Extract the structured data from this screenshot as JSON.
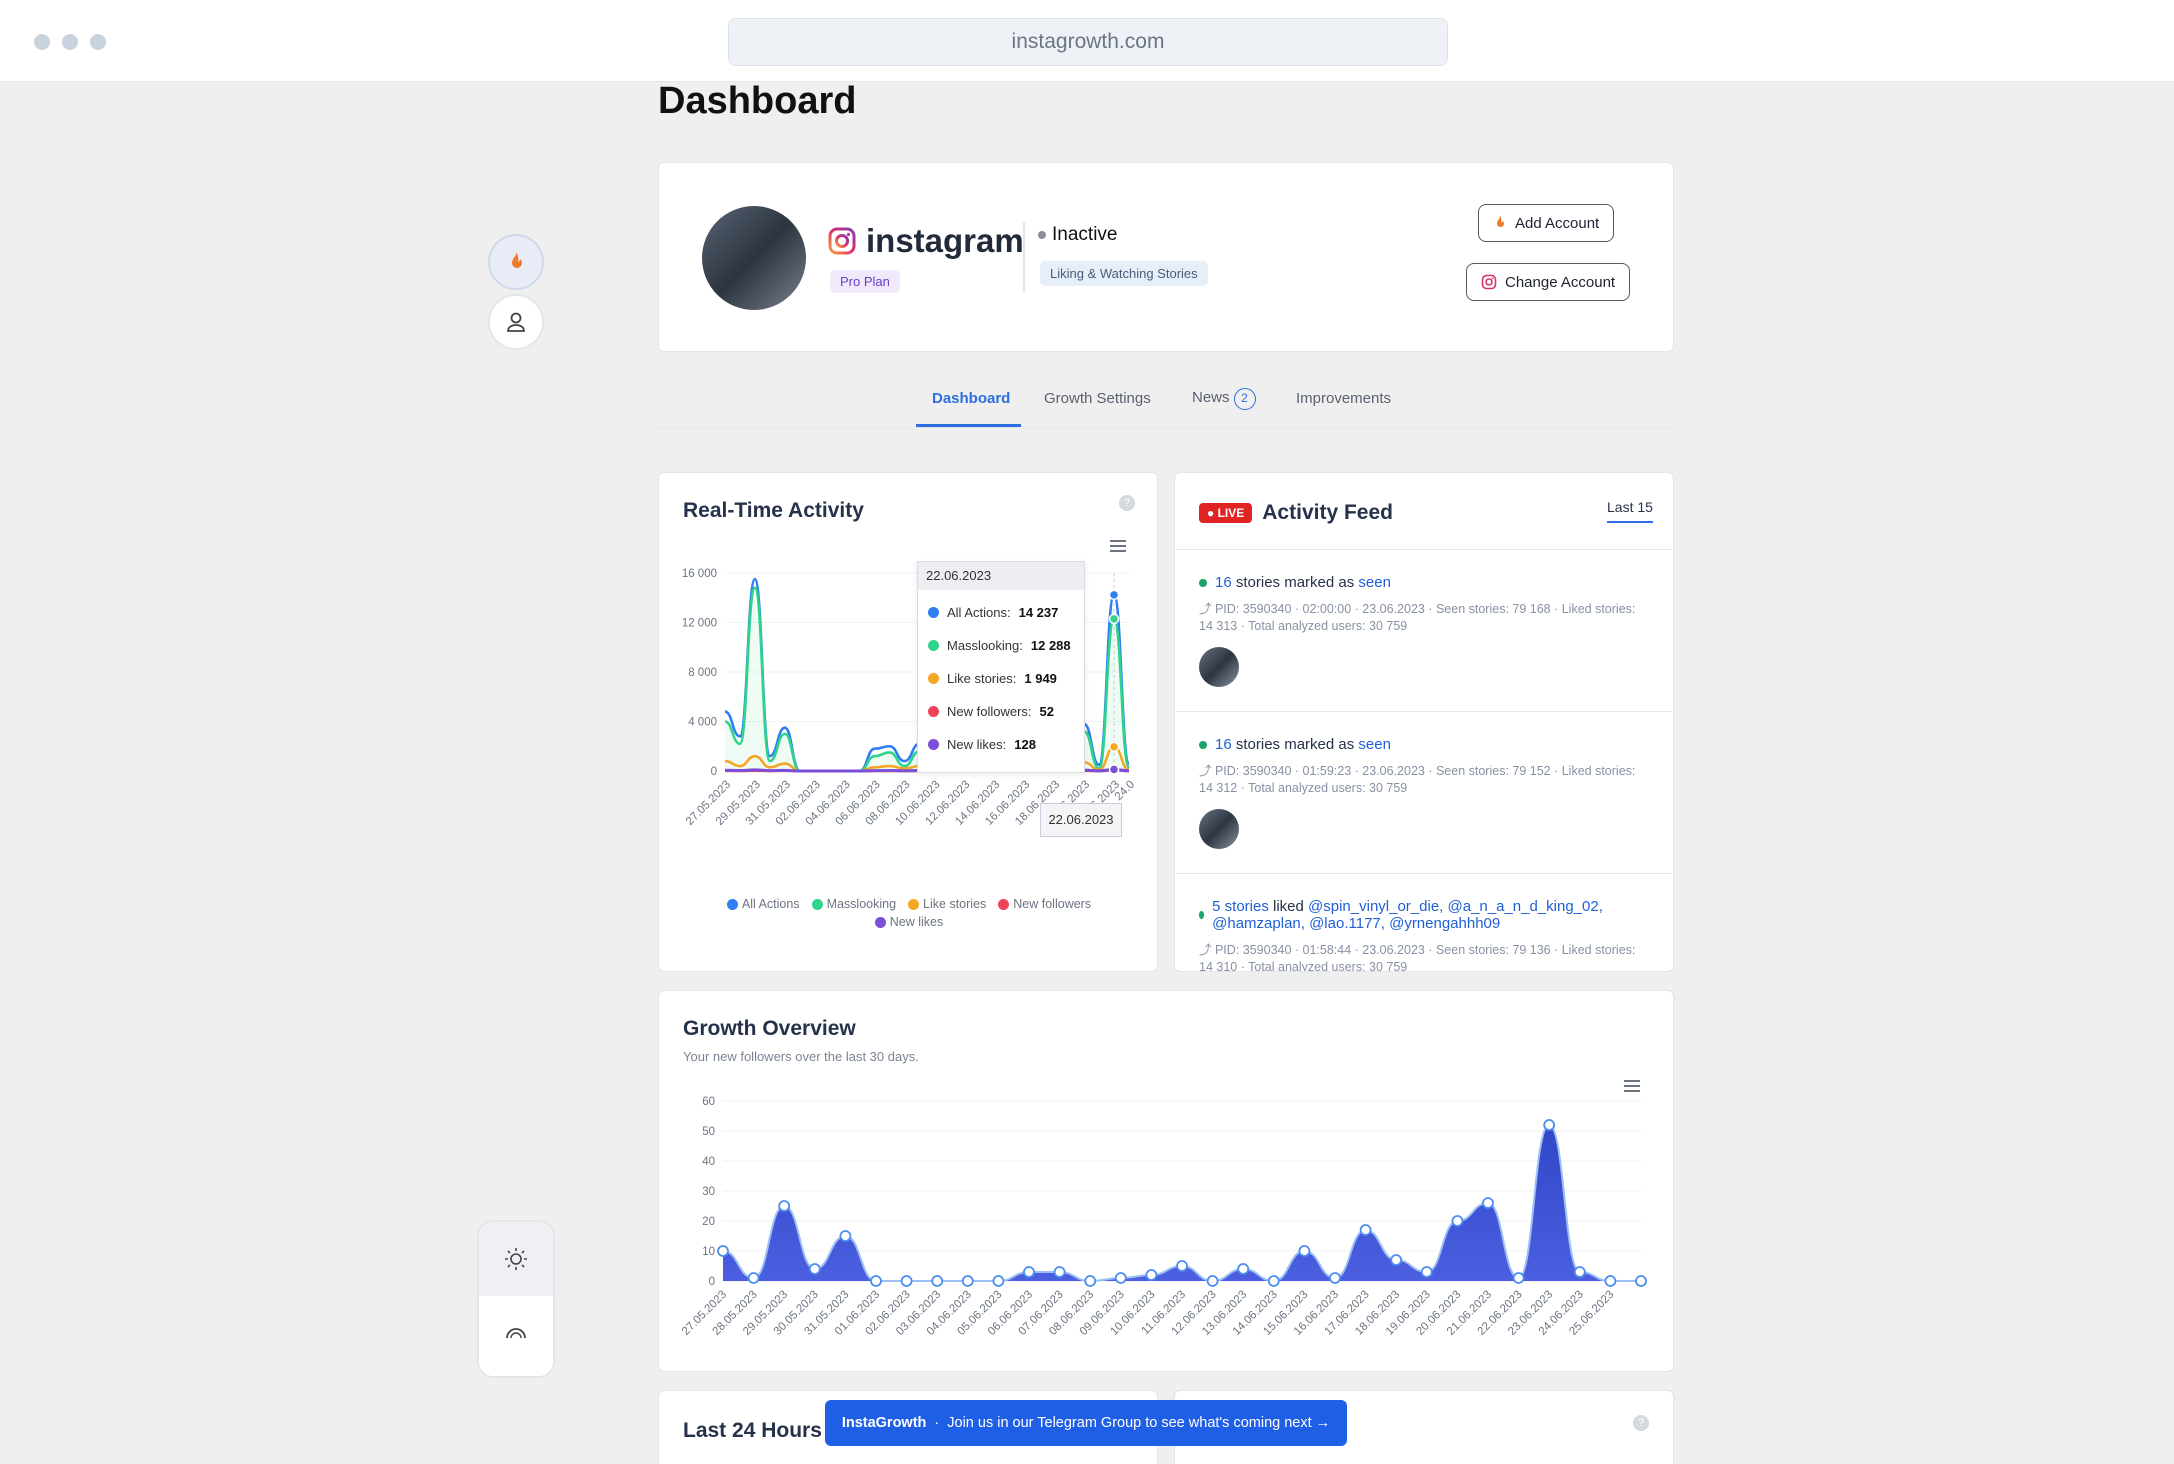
{
  "browser": {
    "url": "instagrowth.com"
  },
  "page": {
    "title": "Dashboard"
  },
  "profile": {
    "name": "instagram",
    "plan": "Pro Plan",
    "status": "Inactive",
    "mode": "Liking & Watching Stories",
    "add_account": "Add Account",
    "change_account": "Change Account"
  },
  "tabs": [
    {
      "label": "Dashboard"
    },
    {
      "label": "Growth Settings"
    },
    {
      "label": "News",
      "badge": "2"
    },
    {
      "label": "Improvements"
    }
  ],
  "realtime": {
    "title": "Real-Time Activity",
    "tooltip": {
      "date": "22.06.2023",
      "rows": [
        {
          "label": "All Actions:",
          "value": "14 237",
          "color": "#2f7ef5"
        },
        {
          "label": "Masslooking:",
          "value": "12 288",
          "color": "#2fd38a"
        },
        {
          "label": "Like stories:",
          "value": "1 949",
          "color": "#f5a623"
        },
        {
          "label": "New followers:",
          "value": "52",
          "color": "#ef4358"
        },
        {
          "label": "New likes:",
          "value": "128",
          "color": "#7b4fd6"
        }
      ]
    },
    "xhover": "22.06.2023",
    "legend": [
      {
        "name": "All Actions",
        "color": "#2f7ef5"
      },
      {
        "name": "Masslooking",
        "color": "#2fd38a"
      },
      {
        "name": "Like stories",
        "color": "#f5a623"
      },
      {
        "name": "New followers",
        "color": "#ef4358"
      },
      {
        "name": "New likes",
        "color": "#7b4fd6"
      }
    ]
  },
  "feed": {
    "live": "LIVE",
    "title": "Activity Feed",
    "filter": "Last 15",
    "items": [
      {
        "count": "16",
        "text": "stories marked as",
        "action": "seen",
        "meta": "PID: 3590340 · 02:00:00 · 23.06.2023 · Seen stories: 79 168 · Liked stories: 14 313 · Total analyzed users: 30 759"
      },
      {
        "count": "16",
        "text": "stories marked as",
        "action": "seen",
        "meta": "PID: 3590340 · 01:59:23 · 23.06.2023 · Seen stories: 79 152 · Liked stories: 14 312 · Total analyzed users: 30 759"
      },
      {
        "count": "5 stories",
        "text": "liked",
        "action": "@spin_vinyl_or_die, @a_n_a_n_d_king_02, @hamzaplan, @lao.1177, @yrnengahhh09",
        "meta": "PID: 3590340 · 01:58:44 · 23.06.2023 · Seen stories: 79 136 · Liked stories: 14 310 · Total analyzed users: 30 759"
      }
    ]
  },
  "growth": {
    "title": "Growth Overview",
    "subtitle": "Your new followers over the last 30 days."
  },
  "bottom": {
    "title": "Last 24 Hours"
  },
  "banner": {
    "brand": "InstaGrowth",
    "sep": "·",
    "text": "Join us in our Telegram Group to see what's coming next →"
  },
  "chart_data": [
    {
      "type": "line",
      "title": "Real-Time Activity",
      "ylim": [
        0,
        16000
      ],
      "yticks": [
        0,
        4000,
        8000,
        12000,
        16000
      ],
      "ytick_labels": [
        "0",
        "4 000",
        "8 000",
        "12 000",
        "16 000"
      ],
      "x": [
        "27.05.2023",
        "28.05.2023",
        "29.05.2023",
        "30.05.2023",
        "31.05.2023",
        "01.06.2023",
        "02.06.2023",
        "03.06.2023",
        "04.06.2023",
        "05.06.2023",
        "06.06.2023",
        "07.06.2023",
        "08.06.2023",
        "09.06.2023",
        "10.06.2023",
        "11.06.2023",
        "12.06.2023",
        "13.06.2023",
        "14.06.2023",
        "15.06.2023",
        "16.06.2023",
        "17.06.2023",
        "18.06.2023",
        "19.06.2023",
        "20.06.2023",
        "21.06.2023",
        "22.06.2023",
        "23.06.2023"
      ],
      "x_tick_labels": [
        "27.05.2023",
        "29.05.2023",
        "31.05.2023",
        "02.06.2023",
        "04.06.2023",
        "06.06.2023",
        "08.06.2023",
        "10.06.2023",
        "12.06.2023",
        "14.06.2023",
        "16.06.2023",
        "18.06.2023",
        "20.06.2023",
        "22.06.2023",
        "24.0"
      ],
      "series": [
        {
          "name": "All Actions",
          "color": "#2f7ef5",
          "values": [
            4800,
            2800,
            15500,
            1200,
            3500,
            0,
            0,
            0,
            0,
            0,
            1800,
            2000,
            800,
            2200,
            3500,
            500,
            3800,
            600,
            3500,
            500,
            3800,
            500,
            3600,
            700,
            3800,
            500,
            14237,
            600
          ]
        },
        {
          "name": "Masslooking",
          "color": "#2fd38a",
          "values": [
            4000,
            2200,
            14800,
            800,
            3000,
            0,
            0,
            0,
            0,
            0,
            1200,
            1500,
            400,
            1600,
            3000,
            200,
            3200,
            300,
            3000,
            200,
            3200,
            200,
            3000,
            300,
            3200,
            200,
            12288,
            300
          ]
        },
        {
          "name": "Like stories",
          "color": "#f5a623",
          "values": [
            800,
            400,
            1200,
            300,
            600,
            0,
            0,
            0,
            0,
            0,
            300,
            400,
            200,
            400,
            600,
            100,
            700,
            100,
            600,
            100,
            700,
            100,
            600,
            200,
            700,
            100,
            1949,
            100
          ]
        },
        {
          "name": "New followers",
          "color": "#ef4358",
          "values": [
            10,
            5,
            25,
            5,
            15,
            0,
            0,
            0,
            0,
            0,
            5,
            5,
            0,
            5,
            10,
            0,
            10,
            0,
            10,
            0,
            10,
            0,
            10,
            0,
            10,
            0,
            52,
            0
          ]
        },
        {
          "name": "New likes",
          "color": "#7b4fd6",
          "values": [
            60,
            40,
            90,
            30,
            50,
            0,
            0,
            0,
            0,
            0,
            30,
            40,
            20,
            40,
            60,
            10,
            70,
            10,
            60,
            10,
            70,
            10,
            60,
            20,
            70,
            10,
            128,
            10
          ]
        }
      ]
    },
    {
      "type": "area",
      "title": "Growth Overview",
      "ylim": [
        0,
        60
      ],
      "yticks": [
        0,
        10,
        20,
        30,
        40,
        50,
        60
      ],
      "x": [
        "27.05.2023",
        "28.05.2023",
        "29.05.2023",
        "30.05.2023",
        "31.05.2023",
        "01.06.2023",
        "02.06.2023",
        "03.06.2023",
        "04.06.2023",
        "05.06.2023",
        "06.06.2023",
        "07.06.2023",
        "08.06.2023",
        "09.06.2023",
        "10.06.2023",
        "11.06.2023",
        "12.06.2023",
        "13.06.2023",
        "14.06.2023",
        "15.06.2023",
        "16.06.2023",
        "17.06.2023",
        "18.06.2023",
        "19.06.2023",
        "20.06.2023",
        "21.06.2023",
        "22.06.2023",
        "23.06.2023",
        "24.06.2023",
        "25.06.2023"
      ],
      "series": [
        {
          "name": "New followers",
          "color": "#3b4fd0",
          "values": [
            10,
            1,
            25,
            4,
            15,
            0,
            0,
            0,
            0,
            0,
            3,
            3,
            0,
            1,
            2,
            5,
            0,
            4,
            0,
            10,
            1,
            17,
            7,
            3,
            20,
            26,
            1,
            52,
            3,
            0,
            0
          ]
        }
      ]
    }
  ]
}
